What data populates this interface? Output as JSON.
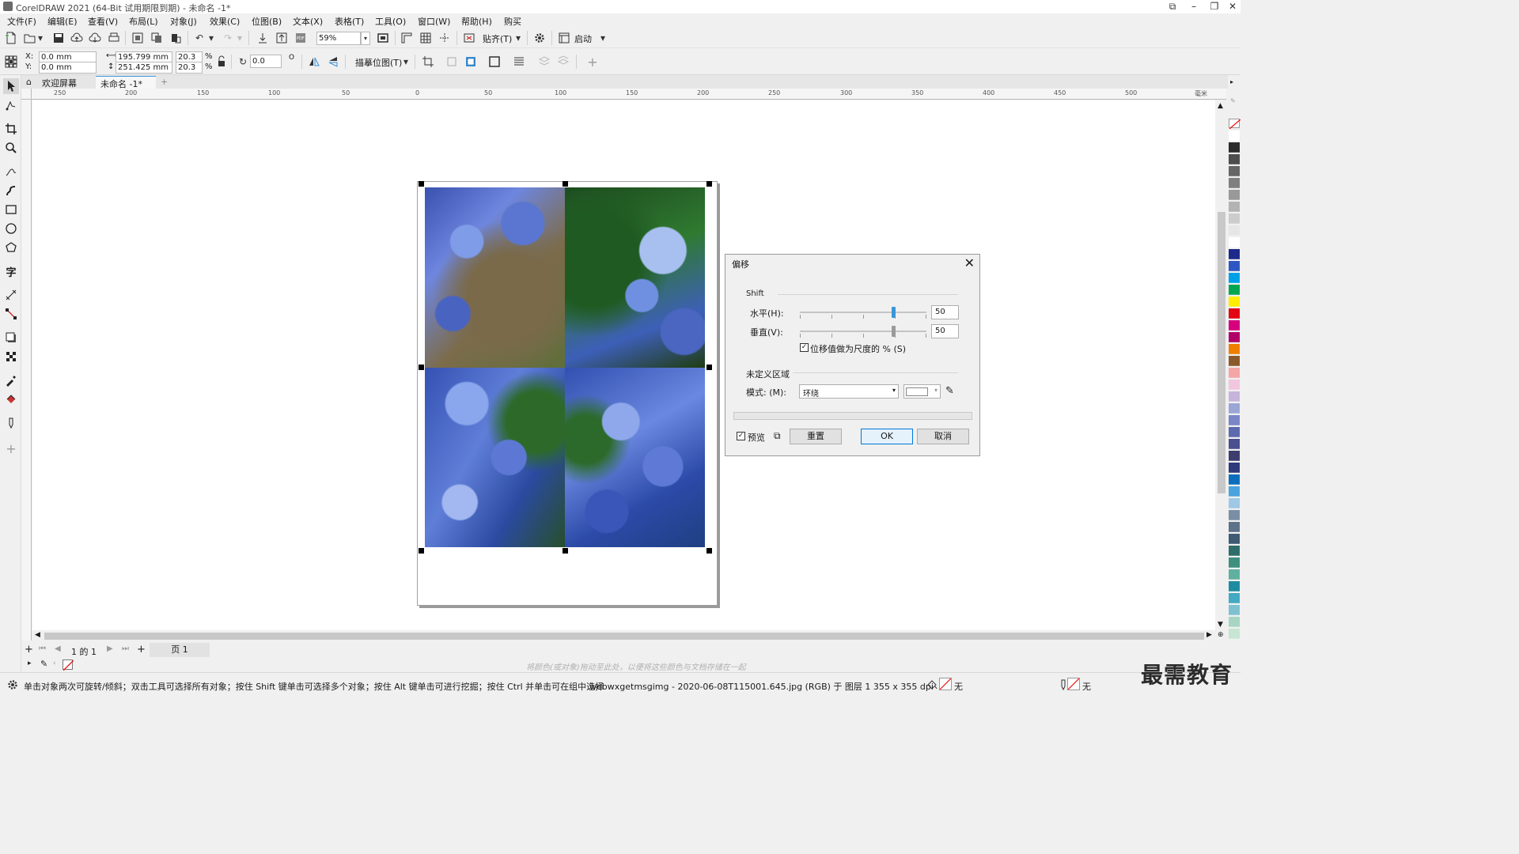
{
  "window": {
    "title": "CorelDRAW 2021 (64-Bit 试用期限到期) - 未命名 -1*"
  },
  "menu": [
    "文件(F)",
    "编辑(E)",
    "查看(V)",
    "布局(L)",
    "对象(J)",
    "效果(C)",
    "位图(B)",
    "文本(X)",
    "表格(T)",
    "工具(O)",
    "窗口(W)",
    "帮助(H)",
    "购买"
  ],
  "toolbar1": {
    "zoom": "59%",
    "snap_label": "贴齐(T)",
    "launch_label": "启动"
  },
  "propertybar": {
    "x_label": "X:",
    "x_value": "0.0 mm",
    "y_label": "Y:",
    "y_value": "0.0 mm",
    "width_value": "195.799 mm",
    "height_value": "251.425 mm",
    "scale_x": "20.3",
    "scale_y": "20.3",
    "percent": "%",
    "rotation": "0.0",
    "degree": "O",
    "trace_label": "描摹位图(T)"
  },
  "tabs": {
    "welcome": "欢迎屏幕",
    "document": "未命名 -1*",
    "add": "+"
  },
  "rulers": {
    "h": [
      "250",
      "200",
      "150",
      "100",
      "50",
      "0",
      "50",
      "100",
      "150",
      "200",
      "250",
      "300",
      "350",
      "400",
      "450",
      "500"
    ],
    "unit": "毫米"
  },
  "dialog": {
    "title": "偏移",
    "group_shift": "Shift",
    "horizontal_label": "水平(H):",
    "horizontal_value": "50",
    "vertical_label": "垂直(V):",
    "vertical_value": "50",
    "percent_checkbox": "位移值做为尺度的 % (S)",
    "group_undefined": "未定义区域",
    "mode_label": "模式: (M):",
    "mode_value": "环绕",
    "preview_label": "预览",
    "reset_label": "重置",
    "ok_label": "OK",
    "cancel_label": "取消"
  },
  "pagenav": {
    "page_counter": "1 的 1",
    "page_tab": "页 1"
  },
  "color_hint": "将颜色(或对象)拖动至此处，以便将这些颜色与文档存储在一起",
  "status": {
    "hint": "单击对象两次可旋转/倾斜；双击工具可选择所有对象；按住 Shift 键单击可选择多个对象；按住 Alt 键单击可进行挖掘；按住 Ctrl 并单击可在组中选择",
    "file_info": "webwxgetmsgimg - 2020-06-08T115001.645.jpg (RGB) 于 图层 1 355 x 355 dpi",
    "fill_none": "无",
    "outline_none": "无"
  },
  "watermark": "最需教育",
  "palette_colors": [
    "#ffffff",
    "#2b2b2b",
    "#4d4d4d",
    "#666666",
    "#808080",
    "#999999",
    "#b3b3b3",
    "#cccccc",
    "#e6e6e6",
    "#ffffff",
    "#1d2a8c",
    "#2e57c3",
    "#00a0e9",
    "#00a650",
    "#ffed00",
    "#e30613",
    "#d6007e",
    "#b2006a",
    "#ee7f00",
    "#8b5a2b",
    "#f4a6a6",
    "#f2c6de",
    "#c6b4dc",
    "#9aa6d6",
    "#7a86c6",
    "#5d6ab0",
    "#4a4f8f",
    "#3d3d6e",
    "#2e3a7a",
    "#0a6ebd",
    "#4aa3df",
    "#9fc7e6",
    "#7a8fa6",
    "#5d7189",
    "#3e5a72",
    "#2f6d6b",
    "#3f8f7f",
    "#5fb09f",
    "#1e8ca0",
    "#44a9c2",
    "#7fc2cf",
    "#a7d5c2",
    "#c7e5d2"
  ]
}
